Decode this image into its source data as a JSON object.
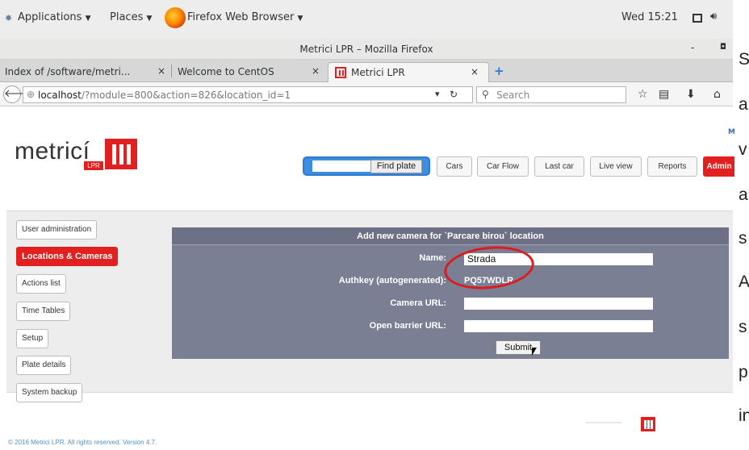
{
  "gnome": {
    "applications": "Applications",
    "places": "Places",
    "app_name": "Firefox Web Browser",
    "caret": "▼",
    "clock": "Wed 15:21"
  },
  "window": {
    "title": "Metrici LPR – Mozilla Firefox",
    "minimize": "-",
    "maximize": "◘"
  },
  "tabs": [
    {
      "label": "Index of /software/metri...",
      "close": "×"
    },
    {
      "label": "Welcome to CentOS",
      "close": "×"
    },
    {
      "label": "Metrici LPR",
      "close": "×"
    }
  ],
  "newtab": "+",
  "navbar": {
    "url_host": "localhost",
    "url_path": "/?module=800&action=826&location_id=1",
    "search_placeholder": "Search"
  },
  "header": {
    "logo_text": "metricí",
    "logo_sub": "LPR",
    "find_label": "Find plate",
    "buttons": [
      "Cars",
      "Car Flow",
      "Last car",
      "Live view",
      "Reports",
      "Admin"
    ],
    "right_label": "M"
  },
  "sidebar": {
    "items": [
      {
        "label": "User administration"
      },
      {
        "label": "Locations & Cameras"
      },
      {
        "label": "Actions list"
      },
      {
        "label": "Time Tables"
      },
      {
        "label": "Setup"
      },
      {
        "label": "Plate details"
      },
      {
        "label": "System backup"
      }
    ]
  },
  "form": {
    "title": "Add new camera for `Parcare birou` location",
    "name_label": "Name:",
    "name_value": "Strada",
    "authkey_label": "Authkey (autogenerated):",
    "authkey_value": "PQ57WDLR",
    "camera_url_label": "Camera URL:",
    "camera_url_value": "",
    "barrier_url_label": "Open barrier URL:",
    "barrier_url_value": "",
    "submit": "Submit"
  },
  "footer": {
    "text": "© 2016 Metrici LPR. All rights reserved. Version 4.7."
  },
  "right_column": [
    "S",
    "a",
    "v",
    "a",
    "s",
    "A",
    "s",
    "p",
    "in"
  ],
  "colors": {
    "brand_red": "#e2201f",
    "form_bg": "#7a7f93",
    "highlight_circle": "#e0191c",
    "find_blue": "#2f7bd0"
  }
}
